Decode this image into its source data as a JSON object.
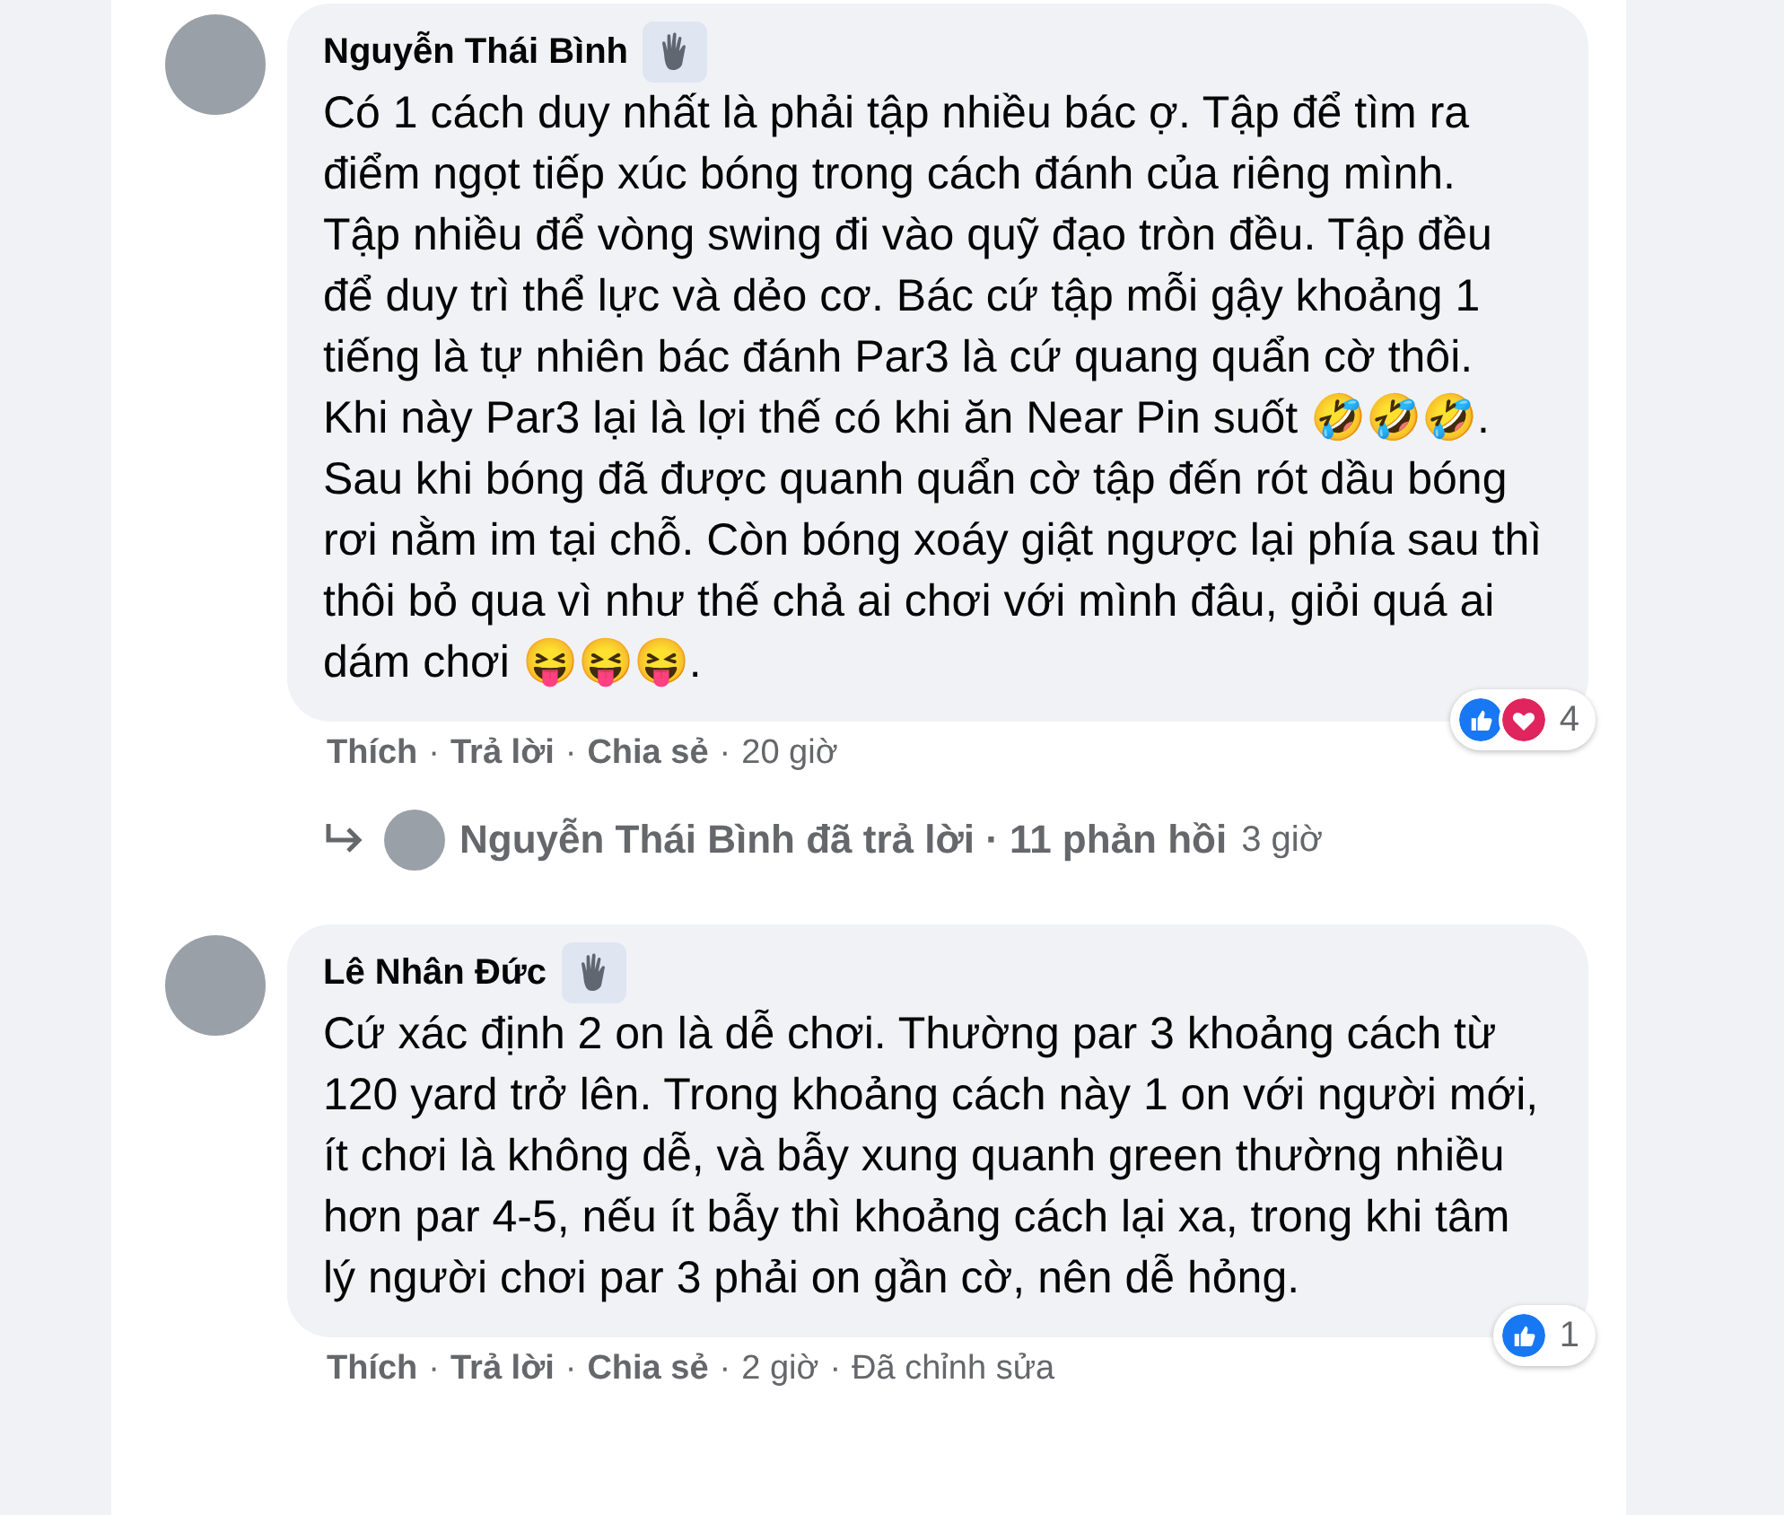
{
  "comments": [
    {
      "author": "Nguyễn Thái Bình",
      "text": "Có 1 cách duy nhất là phải tập nhiều bác ợ. Tập để tìm ra điểm ngọt tiếp xúc bóng trong cách đánh của riêng mình. Tập nhiều để vòng swing đi vào quỹ đạo tròn đều. Tập đều để duy trì thể lực và dẻo cơ. Bác cứ tập mỗi gậy khoảng 1 tiếng là tự nhiên bác đánh Par3 là cứ quang quẩn cờ thôi. Khi này Par3 lại là lợi thế có khi ăn Near Pin suốt 🤣🤣🤣. Sau khi bóng đã được quanh quẩn cờ tập đến rót dầu bóng rơi nằm im tại chỗ. Còn bóng xoáy giật ngược lại phía sau thì thôi bỏ qua vì như thế chả ai chơi với mình đâu, giỏi quá ai dám chơi 😝😝😝.",
      "actions": [
        "Thích",
        "Trả lời",
        "Chia sẻ"
      ],
      "separator": "·",
      "time": "20 giờ",
      "reactions": [
        {
          "kind": "like"
        },
        {
          "kind": "love"
        }
      ],
      "reaction_count": "4",
      "reply_summary": {
        "text": "Nguyễn Thái Bình đã trả lời · 11 phản hồi",
        "time": "3 giờ"
      }
    },
    {
      "author": "Lê Nhân Đức",
      "text": "Cứ xác định 2 on là dễ chơi. Thường par 3 khoảng cách từ 120 yard trở lên. Trong khoảng cách này 1 on với người mới, ít chơi là không dễ, và bẫy xung quanh green thường nhiều hơn par 4-5, nếu ít bẫy thì khoảng cách lại xa, trong khi tâm lý người chơi par 3 phải on gần cờ, nên dễ hỏng.",
      "actions": [
        "Thích",
        "Trả lời",
        "Chia sẻ"
      ],
      "separator": "·",
      "time": "2 giờ",
      "edited": "Đã chỉnh sửa",
      "reactions": [
        {
          "kind": "like"
        }
      ],
      "reaction_count": "1"
    }
  ]
}
